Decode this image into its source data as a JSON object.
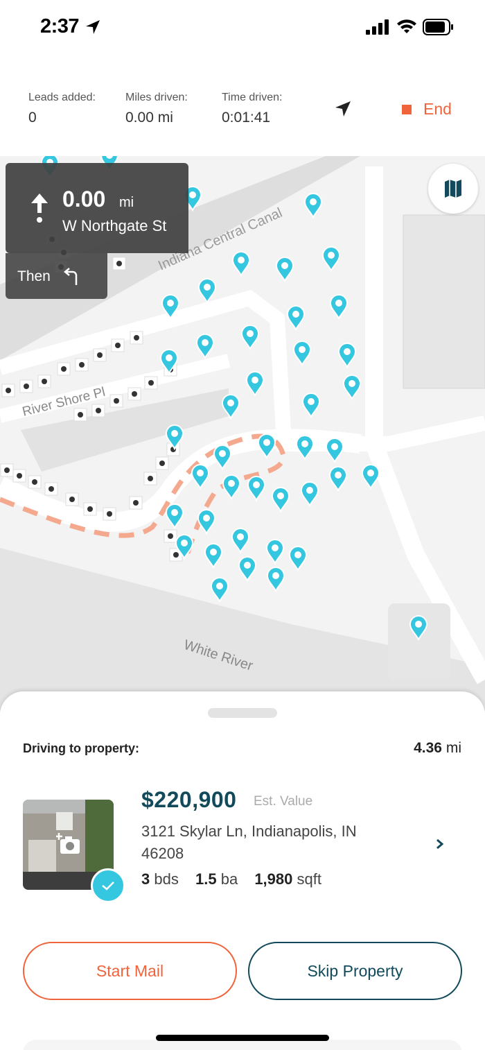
{
  "status_bar": {
    "time": "2:37"
  },
  "stats": {
    "leads_label": "Leads added:",
    "leads_value": "0",
    "miles_label": "Miles driven:",
    "miles_value": "0.00 mi",
    "time_label": "Time driven:",
    "time_value": "0:01:41",
    "end_label": "End"
  },
  "navigation": {
    "distance": "0.00",
    "unit": "mi",
    "street": "W Northgate St",
    "then_label": "Then"
  },
  "map": {
    "labels": {
      "canal": "Indiana Central Canal",
      "river_shore": "River Shore Pl",
      "white_river": "White River"
    }
  },
  "sheet": {
    "driving_label": "Driving to property:",
    "distance_value": "4.36",
    "distance_unit": "mi",
    "property": {
      "price": "$220,900",
      "est_label": "Est. Value",
      "address": "3121 Skylar Ln, Indianapolis, IN 46208",
      "beds_value": "3",
      "beds_unit": "bds",
      "baths_value": "1.5",
      "baths_unit": "ba",
      "sqft_value": "1,980",
      "sqft_unit": "sqft"
    },
    "start_mail_label": "Start Mail",
    "skip_label": "Skip Property"
  },
  "colors": {
    "accent_orange": "#f0643c",
    "pin_blue": "#35c6e0",
    "navy": "#124a5c"
  },
  "icons": [
    "location-arrow-icon",
    "signal-icon",
    "wifi-icon",
    "battery-icon",
    "navigation-icon",
    "stop-icon",
    "up-arrow-icon",
    "turn-left-icon",
    "map-icon",
    "camera-plus-icon",
    "checkmark-icon",
    "chevron-right-icon"
  ]
}
